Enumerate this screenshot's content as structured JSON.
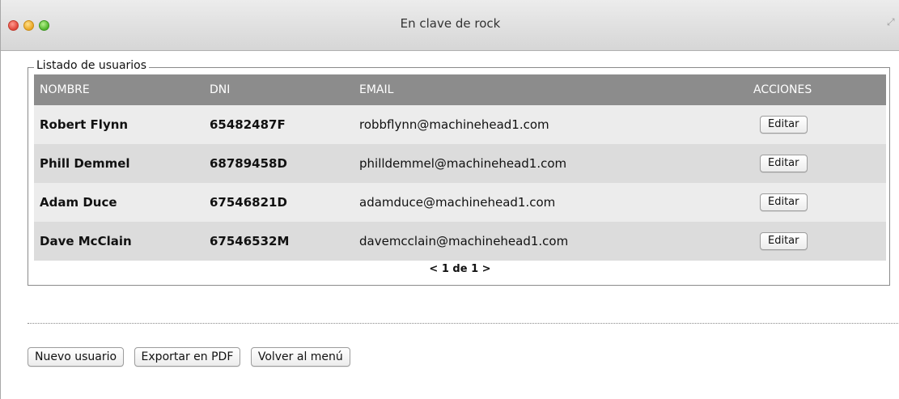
{
  "window": {
    "title": "En clave de rock"
  },
  "panel": {
    "legend": "Listado de usuarios"
  },
  "table": {
    "headers": {
      "name": "NOMBRE",
      "dni": "DNI",
      "email": "EMAIL",
      "actions": "ACCIONES"
    },
    "rows": [
      {
        "name": "Robert Flynn",
        "dni": "65482487F",
        "email": "robbflynn@machinehead1.com",
        "action": "Editar"
      },
      {
        "name": "Phill Demmel",
        "dni": "68789458D",
        "email": "philldemmel@machinehead1.com",
        "action": "Editar"
      },
      {
        "name": "Adam Duce",
        "dni": "67546821D",
        "email": "adamduce@machinehead1.com",
        "action": "Editar"
      },
      {
        "name": "Dave McClain",
        "dni": "67546532M",
        "email": "davemcclain@machinehead1.com",
        "action": "Editar"
      }
    ]
  },
  "pager": {
    "prev": "<",
    "text": "1 de 1",
    "next": ">"
  },
  "buttons": {
    "new_user": "Nuevo usuario",
    "export_pdf": "Exportar en PDF",
    "back_menu": "Volver al menú"
  },
  "icons": {
    "close": "close-icon",
    "minimize": "minimize-icon",
    "maximize": "maximize-icon",
    "fullscreen": "fullscreen-icon"
  },
  "colors": {
    "header_bg": "#8c8c8c",
    "row_odd": "#ececec",
    "row_even": "#dcdcdc"
  }
}
